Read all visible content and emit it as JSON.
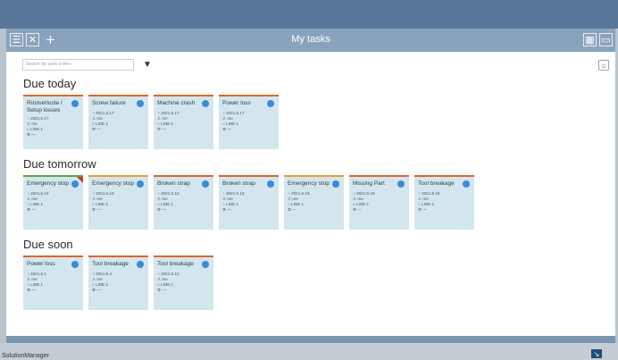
{
  "header": {
    "title": "My tasks"
  },
  "toolbar": {
    "icons": [
      "tasks-icon",
      "tools-icon",
      "plus-icon"
    ],
    "right_icons": [
      "grid-icon",
      "inbox-icon"
    ]
  },
  "search": {
    "placeholder": "Search for work orders"
  },
  "sections": [
    {
      "title": "Due today",
      "cards": [
        {
          "title": "Rüstverluste / Setup losses",
          "date": "2021.5.17",
          "user": "me",
          "line": "LINE 1",
          "extra": "—",
          "accent": "#e0642c"
        },
        {
          "title": "Screw failure",
          "date": "2021.5.17",
          "user": "me",
          "line": "LINE 1",
          "extra": "—",
          "accent": "#e0642c"
        },
        {
          "title": "Machine crash",
          "date": "2021.5.17",
          "user": "me",
          "line": "LINE 1",
          "extra": "—",
          "accent": "#e0642c"
        },
        {
          "title": "Power loss",
          "date": "2021.5.17",
          "user": "me",
          "line": "LINE 1",
          "extra": "—",
          "accent": "#e0642c"
        }
      ]
    },
    {
      "title": "Due tomorrow",
      "cards": [
        {
          "title": "Emergency stop",
          "date": "2021.5.18",
          "user": "me",
          "line": "LINE 1",
          "extra": "—",
          "accent": "#58a845"
        },
        {
          "title": "Emergency stop",
          "date": "2021.5.18",
          "user": "me",
          "line": "LINE 1",
          "extra": "—",
          "accent": "#e8a030"
        },
        {
          "title": "Broken strap",
          "date": "2021.5.18",
          "user": "me",
          "line": "LINE 1",
          "extra": "—",
          "accent": "#e0642c"
        },
        {
          "title": "Broken strap",
          "date": "2021.5.18",
          "user": "me",
          "line": "LINE 1",
          "extra": "—",
          "accent": "#e0642c"
        },
        {
          "title": "Emergency stop",
          "date": "2021.5.18",
          "user": "me",
          "line": "LINE 1",
          "extra": "—",
          "accent": "#e8a030"
        },
        {
          "title": "Missing Part",
          "date": "2021.5.18",
          "user": "me",
          "line": "LINE 1",
          "extra": "—",
          "accent": "#e0642c"
        },
        {
          "title": "Tool breakage",
          "date": "2021.5.18",
          "user": "me",
          "line": "LINE 1",
          "extra": "—",
          "accent": "#e0642c"
        }
      ]
    },
    {
      "title": "Due soon",
      "cards": [
        {
          "title": "Power loss",
          "date": "2021.6.1",
          "user": "me",
          "line": "LINE 1",
          "extra": "—",
          "accent": "#e0642c"
        },
        {
          "title": "Tool breakage",
          "date": "2021.6.4",
          "user": "me",
          "line": "LINE 1",
          "extra": "—",
          "accent": "#e0642c"
        },
        {
          "title": "Tool breakage",
          "date": "2021.6.10",
          "user": "me",
          "line": "LINE 1",
          "extra": "—",
          "accent": "#e0642c"
        }
      ]
    }
  ],
  "footer": {
    "text": "SolutionManager"
  }
}
